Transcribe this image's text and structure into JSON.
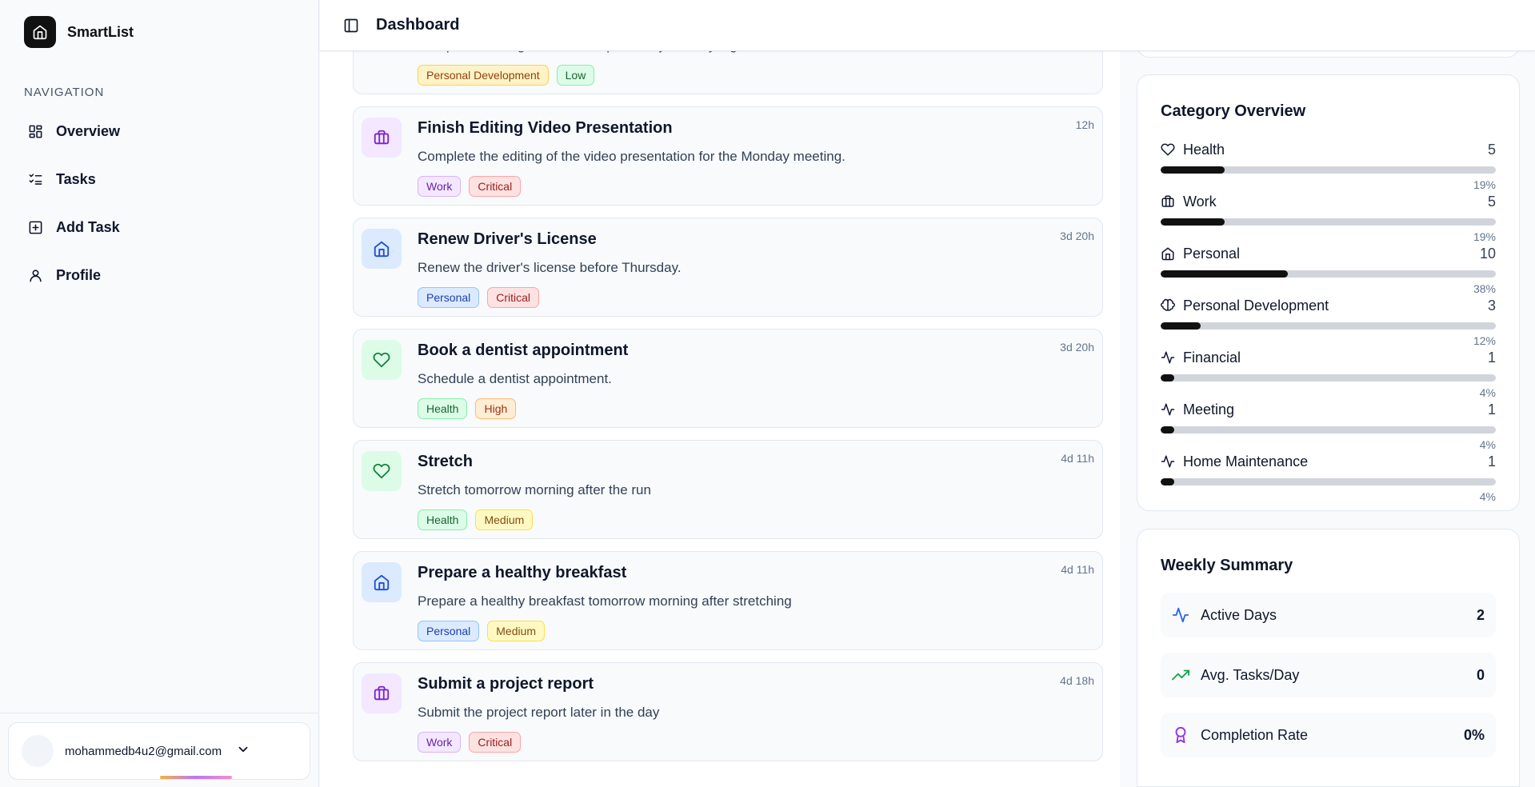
{
  "app": {
    "name": "SmartList"
  },
  "header": {
    "title": "Dashboard"
  },
  "nav": {
    "heading": "NAVIGATION",
    "items": [
      {
        "label": "Overview",
        "icon": "grid-icon"
      },
      {
        "label": "Tasks",
        "icon": "list-checks-icon"
      },
      {
        "label": "Add Task",
        "icon": "plus-square-icon"
      },
      {
        "label": "Profile",
        "icon": "user-icon"
      }
    ]
  },
  "user": {
    "email": "mohammedb4u2@gmail.com"
  },
  "tasks": [
    {
      "title": "",
      "description": "Complete reading the leadership book by Sunday night.",
      "time": "",
      "icon": "brain-icon",
      "tags": [
        "Personal Development",
        "Low"
      ]
    },
    {
      "title": "Finish Editing Video Presentation",
      "description": "Complete the editing of the video presentation for the Monday meeting.",
      "time": "12h",
      "icon": "briefcase-icon",
      "tags": [
        "Work",
        "Critical"
      ]
    },
    {
      "title": "Renew Driver's License",
      "description": "Renew the driver's license before Thursday.",
      "time": "3d 20h",
      "icon": "home-icon",
      "tags": [
        "Personal",
        "Critical"
      ]
    },
    {
      "title": "Book a dentist appointment",
      "description": "Schedule a dentist appointment.",
      "time": "3d 20h",
      "icon": "heart-icon",
      "tags": [
        "Health",
        "High"
      ]
    },
    {
      "title": "Stretch",
      "description": "Stretch tomorrow morning after the run",
      "time": "4d 11h",
      "icon": "heart-icon",
      "tags": [
        "Health",
        "Medium"
      ]
    },
    {
      "title": "Prepare a healthy breakfast",
      "description": "Prepare a healthy breakfast tomorrow morning after stretching",
      "time": "4d 11h",
      "icon": "home-icon",
      "tags": [
        "Personal",
        "Medium"
      ]
    },
    {
      "title": "Submit a project report",
      "description": "Submit the project report later in the day",
      "time": "4d 18h",
      "icon": "briefcase-icon",
      "tags": [
        "Work",
        "Critical"
      ]
    }
  ],
  "category_overview": {
    "title": "Category Overview",
    "items": [
      {
        "name": "Health",
        "count": "5",
        "pct": "19%",
        "fill": 0.19,
        "icon": "heart-icon"
      },
      {
        "name": "Work",
        "count": "5",
        "pct": "19%",
        "fill": 0.19,
        "icon": "briefcase-icon"
      },
      {
        "name": "Personal",
        "count": "10",
        "pct": "38%",
        "fill": 0.38,
        "icon": "home-icon"
      },
      {
        "name": "Personal Development",
        "count": "3",
        "pct": "12%",
        "fill": 0.12,
        "icon": "brain-icon"
      },
      {
        "name": "Financial",
        "count": "1",
        "pct": "4%",
        "fill": 0.04,
        "icon": "activity-icon"
      },
      {
        "name": "Meeting",
        "count": "1",
        "pct": "4%",
        "fill": 0.04,
        "icon": "activity-icon"
      },
      {
        "name": "Home Maintenance",
        "count": "1",
        "pct": "4%",
        "fill": 0.04,
        "icon": "activity-icon"
      }
    ]
  },
  "weekly_summary": {
    "title": "Weekly Summary",
    "stats": [
      {
        "label": "Active Days",
        "value": "2",
        "icon": "activity-icon",
        "color": "#2563eb"
      },
      {
        "label": "Avg. Tasks/Day",
        "value": "0",
        "icon": "trending-up-icon",
        "color": "#16a34a"
      },
      {
        "label": "Completion Rate",
        "value": "0%",
        "icon": "award-icon",
        "color": "#9333ea"
      }
    ]
  },
  "colors": {
    "tag_styles": {
      "Personal Development": {
        "bg": "#fef3c7",
        "fg": "#92400e",
        "border": "#fcd34d"
      },
      "Low": {
        "bg": "#dcfce7",
        "fg": "#166534",
        "border": "#86efac"
      },
      "Work": {
        "bg": "#f3e8ff",
        "fg": "#6b21a8",
        "border": "#d8b4fe"
      },
      "Critical": {
        "bg": "#fee2e2",
        "fg": "#991b1b",
        "border": "#fca5a5"
      },
      "Personal": {
        "bg": "#dbeafe",
        "fg": "#1e40af",
        "border": "#93c5fd"
      },
      "Health": {
        "bg": "#dcfce7",
        "fg": "#166534",
        "border": "#86efac"
      },
      "High": {
        "bg": "#ffedd5",
        "fg": "#9a3412",
        "border": "#fdba74"
      },
      "Medium": {
        "bg": "#fef9c3",
        "fg": "#854d0e",
        "border": "#fde047"
      }
    },
    "icon_styles": {
      "brain-icon": {
        "bg": "#fef3c7",
        "fg": "#b45309"
      },
      "briefcase-icon": {
        "bg": "#f3e8ff",
        "fg": "#7e22ce"
      },
      "home-icon": {
        "bg": "#dbeafe",
        "fg": "#1d4ed8"
      },
      "heart-icon": {
        "bg": "#dcfce7",
        "fg": "#15803d"
      }
    }
  }
}
